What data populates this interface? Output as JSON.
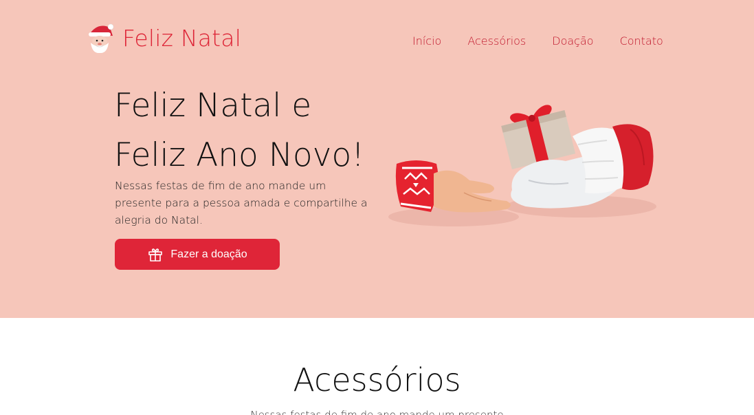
{
  "brand": {
    "name": "Feliz Natal",
    "icon": "santa-icon"
  },
  "nav": {
    "items": [
      "Início",
      "Acessórios",
      "Doação",
      "Contato"
    ]
  },
  "hero": {
    "title_line1": "Feliz Natal e",
    "title_line2": "Feliz Ano Novo!",
    "description": "Nessas festas de fim de ano mande um presente para a pessoa amada e compartilhe a alegria do Natal.",
    "cta_label": "Fazer a doação",
    "cta_icon": "gift-icon",
    "illustration": "hands-giving-gift"
  },
  "accessories": {
    "title": "Acessórios",
    "subtitle": "Nessas festas de fim de ano mande um presente"
  },
  "colors": {
    "brand": "#dd2436",
    "hero_bg": "#f6c6ba",
    "cta_bg": "#df2538"
  }
}
